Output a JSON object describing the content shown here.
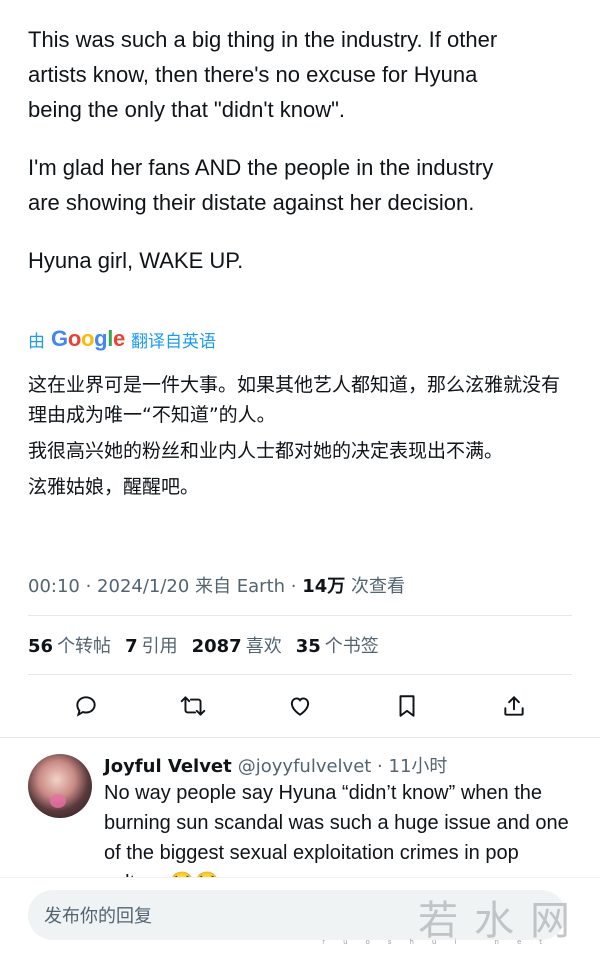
{
  "tweet": {
    "original_paragraphs": [
      "This was such a big thing in the industry. If other\nartists know, then there's no excuse for Hyuna\nbeing the only that \"didn't know\".",
      "I'm glad her fans AND the people in the industry\nare showing their distate against her decision.",
      "Hyuna girl, WAKE UP."
    ],
    "translate_prefix": "由",
    "translate_brand": "Google",
    "translate_suffix": "翻译自英语",
    "translated_paragraphs": [
      "这在业界可是一件大事。如果其他艺人都知道，那么泫雅就没有理由成为唯一“不知道”的人。",
      "我很高兴她的粉丝和业内人士都对她的决定表现出不满。",
      "泫雅姑娘，醒醒吧。"
    ],
    "meta_prefix": "00:10 · 2024/1/20 来自 Earth · ",
    "views_count": "14万",
    "views_label": " 次查看",
    "stats": {
      "reposts_count": "56",
      "reposts_label": "个转帖",
      "quotes_count": "7",
      "quotes_label": "引用",
      "likes_count": "2087",
      "likes_label": "喜欢",
      "bookmarks_count": "35",
      "bookmarks_label": "个书签"
    },
    "icons": [
      "reply-icon",
      "repost-icon",
      "like-icon",
      "bookmark-icon",
      "share-icon"
    ]
  },
  "reply": {
    "name": "Joyful Velvet",
    "handle_time": "@joyyfulvelvet · 11小时",
    "text": "No way people say Hyuna “didn’t know” when the burning sun scandal was such a huge issue and one of the biggest sexual exploitation crimes in pop culture 😭😭"
  },
  "composer": {
    "placeholder": "发布你的回复"
  },
  "watermark": {
    "text": "若水网",
    "subtext": "ruoshui net"
  }
}
